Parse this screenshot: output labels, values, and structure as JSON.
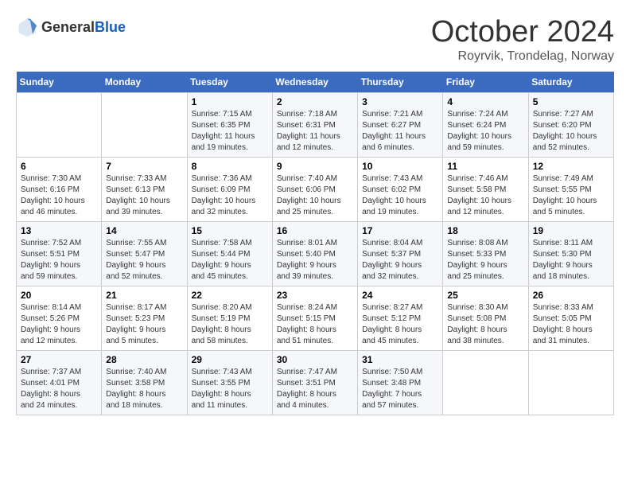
{
  "header": {
    "logo_general": "General",
    "logo_blue": "Blue",
    "month_title": "October 2024",
    "location": "Royrvik, Trondelag, Norway"
  },
  "days_of_week": [
    "Sunday",
    "Monday",
    "Tuesday",
    "Wednesday",
    "Thursday",
    "Friday",
    "Saturday"
  ],
  "weeks": [
    [
      {
        "day": "",
        "info": ""
      },
      {
        "day": "",
        "info": ""
      },
      {
        "day": "1",
        "info": "Sunrise: 7:15 AM\nSunset: 6:35 PM\nDaylight: 11 hours\nand 19 minutes."
      },
      {
        "day": "2",
        "info": "Sunrise: 7:18 AM\nSunset: 6:31 PM\nDaylight: 11 hours\nand 12 minutes."
      },
      {
        "day": "3",
        "info": "Sunrise: 7:21 AM\nSunset: 6:27 PM\nDaylight: 11 hours\nand 6 minutes."
      },
      {
        "day": "4",
        "info": "Sunrise: 7:24 AM\nSunset: 6:24 PM\nDaylight: 10 hours\nand 59 minutes."
      },
      {
        "day": "5",
        "info": "Sunrise: 7:27 AM\nSunset: 6:20 PM\nDaylight: 10 hours\nand 52 minutes."
      }
    ],
    [
      {
        "day": "6",
        "info": "Sunrise: 7:30 AM\nSunset: 6:16 PM\nDaylight: 10 hours\nand 46 minutes."
      },
      {
        "day": "7",
        "info": "Sunrise: 7:33 AM\nSunset: 6:13 PM\nDaylight: 10 hours\nand 39 minutes."
      },
      {
        "day": "8",
        "info": "Sunrise: 7:36 AM\nSunset: 6:09 PM\nDaylight: 10 hours\nand 32 minutes."
      },
      {
        "day": "9",
        "info": "Sunrise: 7:40 AM\nSunset: 6:06 PM\nDaylight: 10 hours\nand 25 minutes."
      },
      {
        "day": "10",
        "info": "Sunrise: 7:43 AM\nSunset: 6:02 PM\nDaylight: 10 hours\nand 19 minutes."
      },
      {
        "day": "11",
        "info": "Sunrise: 7:46 AM\nSunset: 5:58 PM\nDaylight: 10 hours\nand 12 minutes."
      },
      {
        "day": "12",
        "info": "Sunrise: 7:49 AM\nSunset: 5:55 PM\nDaylight: 10 hours\nand 5 minutes."
      }
    ],
    [
      {
        "day": "13",
        "info": "Sunrise: 7:52 AM\nSunset: 5:51 PM\nDaylight: 9 hours\nand 59 minutes."
      },
      {
        "day": "14",
        "info": "Sunrise: 7:55 AM\nSunset: 5:47 PM\nDaylight: 9 hours\nand 52 minutes."
      },
      {
        "day": "15",
        "info": "Sunrise: 7:58 AM\nSunset: 5:44 PM\nDaylight: 9 hours\nand 45 minutes."
      },
      {
        "day": "16",
        "info": "Sunrise: 8:01 AM\nSunset: 5:40 PM\nDaylight: 9 hours\nand 39 minutes."
      },
      {
        "day": "17",
        "info": "Sunrise: 8:04 AM\nSunset: 5:37 PM\nDaylight: 9 hours\nand 32 minutes."
      },
      {
        "day": "18",
        "info": "Sunrise: 8:08 AM\nSunset: 5:33 PM\nDaylight: 9 hours\nand 25 minutes."
      },
      {
        "day": "19",
        "info": "Sunrise: 8:11 AM\nSunset: 5:30 PM\nDaylight: 9 hours\nand 18 minutes."
      }
    ],
    [
      {
        "day": "20",
        "info": "Sunrise: 8:14 AM\nSunset: 5:26 PM\nDaylight: 9 hours\nand 12 minutes."
      },
      {
        "day": "21",
        "info": "Sunrise: 8:17 AM\nSunset: 5:23 PM\nDaylight: 9 hours\nand 5 minutes."
      },
      {
        "day": "22",
        "info": "Sunrise: 8:20 AM\nSunset: 5:19 PM\nDaylight: 8 hours\nand 58 minutes."
      },
      {
        "day": "23",
        "info": "Sunrise: 8:24 AM\nSunset: 5:15 PM\nDaylight: 8 hours\nand 51 minutes."
      },
      {
        "day": "24",
        "info": "Sunrise: 8:27 AM\nSunset: 5:12 PM\nDaylight: 8 hours\nand 45 minutes."
      },
      {
        "day": "25",
        "info": "Sunrise: 8:30 AM\nSunset: 5:08 PM\nDaylight: 8 hours\nand 38 minutes."
      },
      {
        "day": "26",
        "info": "Sunrise: 8:33 AM\nSunset: 5:05 PM\nDaylight: 8 hours\nand 31 minutes."
      }
    ],
    [
      {
        "day": "27",
        "info": "Sunrise: 7:37 AM\nSunset: 4:01 PM\nDaylight: 8 hours\nand 24 minutes."
      },
      {
        "day": "28",
        "info": "Sunrise: 7:40 AM\nSunset: 3:58 PM\nDaylight: 8 hours\nand 18 minutes."
      },
      {
        "day": "29",
        "info": "Sunrise: 7:43 AM\nSunset: 3:55 PM\nDaylight: 8 hours\nand 11 minutes."
      },
      {
        "day": "30",
        "info": "Sunrise: 7:47 AM\nSunset: 3:51 PM\nDaylight: 8 hours\nand 4 minutes."
      },
      {
        "day": "31",
        "info": "Sunrise: 7:50 AM\nSunset: 3:48 PM\nDaylight: 7 hours\nand 57 minutes."
      },
      {
        "day": "",
        "info": ""
      },
      {
        "day": "",
        "info": ""
      }
    ]
  ]
}
